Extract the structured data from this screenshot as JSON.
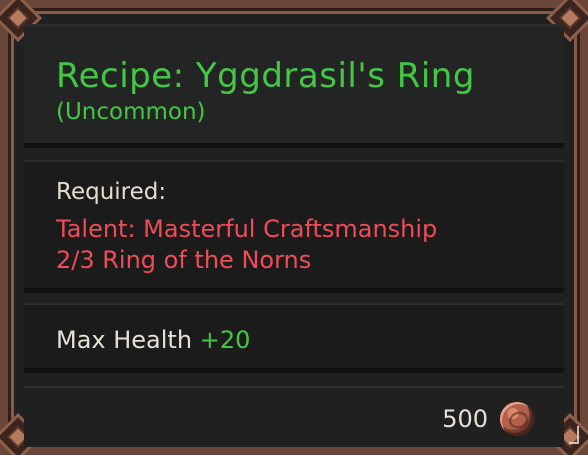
{
  "tooltip": {
    "title": "Recipe: Yggdrasil's Ring",
    "rarity": "(Uncommon)",
    "requirements": {
      "label": "Required:",
      "items": [
        "Talent: Masterful Craftsmanship",
        "2/3 Ring of the Norns"
      ]
    },
    "stats": [
      {
        "name": "Max Health",
        "value": "+20"
      }
    ],
    "price": {
      "value": "500",
      "icon": "copper-coin-icon"
    }
  },
  "colors": {
    "frame": "#6a4638",
    "title_green": "#43c843",
    "requirement_red": "#ef4c57",
    "body_text": "#e6e1d7",
    "coin": "#b25f4b"
  }
}
